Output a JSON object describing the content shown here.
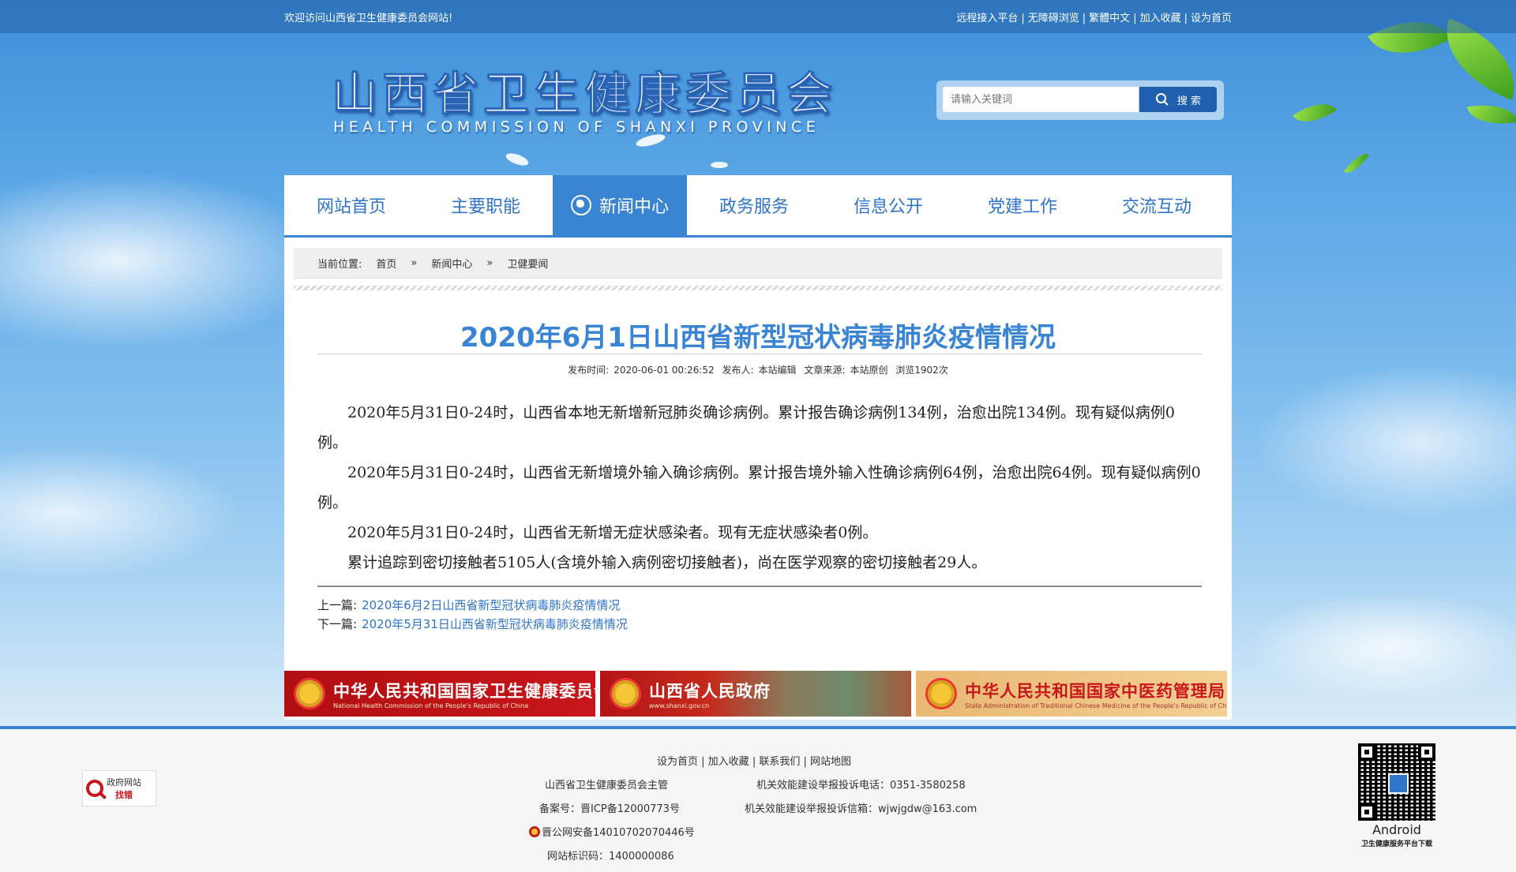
{
  "topbar": {
    "welcome": "欢迎访问山西省卫生健康委员会网站!",
    "links": [
      "远程接入平台",
      "无障碍浏览",
      "繁體中文",
      "加入收藏",
      "设为首页"
    ]
  },
  "logo": {
    "cn": "山西省卫生健康委员会",
    "en": "HEALTH COMMISSION OF SHANXI PROVINCE"
  },
  "search": {
    "placeholder": "请输入关键词",
    "button": "搜 索"
  },
  "nav": {
    "items": [
      {
        "label": "网站首页",
        "active": false
      },
      {
        "label": "主要职能",
        "active": false
      },
      {
        "label": "新闻中心",
        "active": true
      },
      {
        "label": "政务服务",
        "active": false
      },
      {
        "label": "信息公开",
        "active": false
      },
      {
        "label": "党建工作",
        "active": false
      },
      {
        "label": "交流互动",
        "active": false
      }
    ],
    "active_color": "#3a84d4"
  },
  "breadcrumb": {
    "prefix": "当前位置:",
    "items": [
      "首页",
      "新闻中心",
      "卫健要闻"
    ],
    "separator": "»"
  },
  "article": {
    "title": "2020年6月1日山西省新型冠状病毒肺炎疫情情况",
    "meta": {
      "time_label": "发布时间:",
      "time": "2020-06-01 00:26:52",
      "author_label": "发布人:",
      "author": "本站编辑",
      "source_label": "文章来源:",
      "source": "本站原创",
      "views": "浏览1902次"
    },
    "paragraphs": [
      "2020年5月31日0-24时，山西省本地无新增新冠肺炎确诊病例。累计报告确诊病例134例，治愈出院134例。现有疑似病例0例。",
      "2020年5月31日0-24时，山西省无新增境外输入确诊病例。累计报告境外输入性确诊病例64例，治愈出院64例。现有疑似病例0例。",
      "2020年5月31日0-24时，山西省无新增无症状感染者。现有无症状感染者0例。",
      "累计追踪到密切接触者5105人(含境外输入病例密切接触者)，尚在医学观察的密切接触者29人。"
    ],
    "prev_label": "上一篇:",
    "prev_title": "2020年6月2日山西省新型冠状病毒肺炎疫情情况",
    "next_label": "下一篇:",
    "next_title": "2020年5月31日山西省新型冠状病毒肺炎疫情情况"
  },
  "banners": [
    {
      "cn": "中华人民共和国国家卫生健康委员会",
      "en": "National Health Commission of the People's Republic of China"
    },
    {
      "cn": "山西省人民政府",
      "en": "www.shanxi.gov.cn"
    },
    {
      "cn": "中华人民共和国国家中医药管理局",
      "en": "State Administration of Traditional Chinese Medicine of the People's Republic of China"
    }
  ],
  "footer": {
    "links": [
      "设为首页",
      "加入收藏",
      "联系我们",
      "网站地图"
    ],
    "sponsor": "山西省卫生健康委员会主管",
    "icp": "备案号：晋ICP备12000773号",
    "police": "晋公网安备14010702070446号",
    "site_id": "网站标识码：1400000086",
    "complaint_phone": "机关效能建设举报投诉电话：0351-3580258",
    "complaint_email": "机关效能建设举报投诉信箱：wjwjgdw@163.com",
    "gov_badge_line1": "政府网站",
    "gov_badge_line2": "找错",
    "qr_label": "Android",
    "qr_caption": "卫生健康服务平台下载"
  }
}
